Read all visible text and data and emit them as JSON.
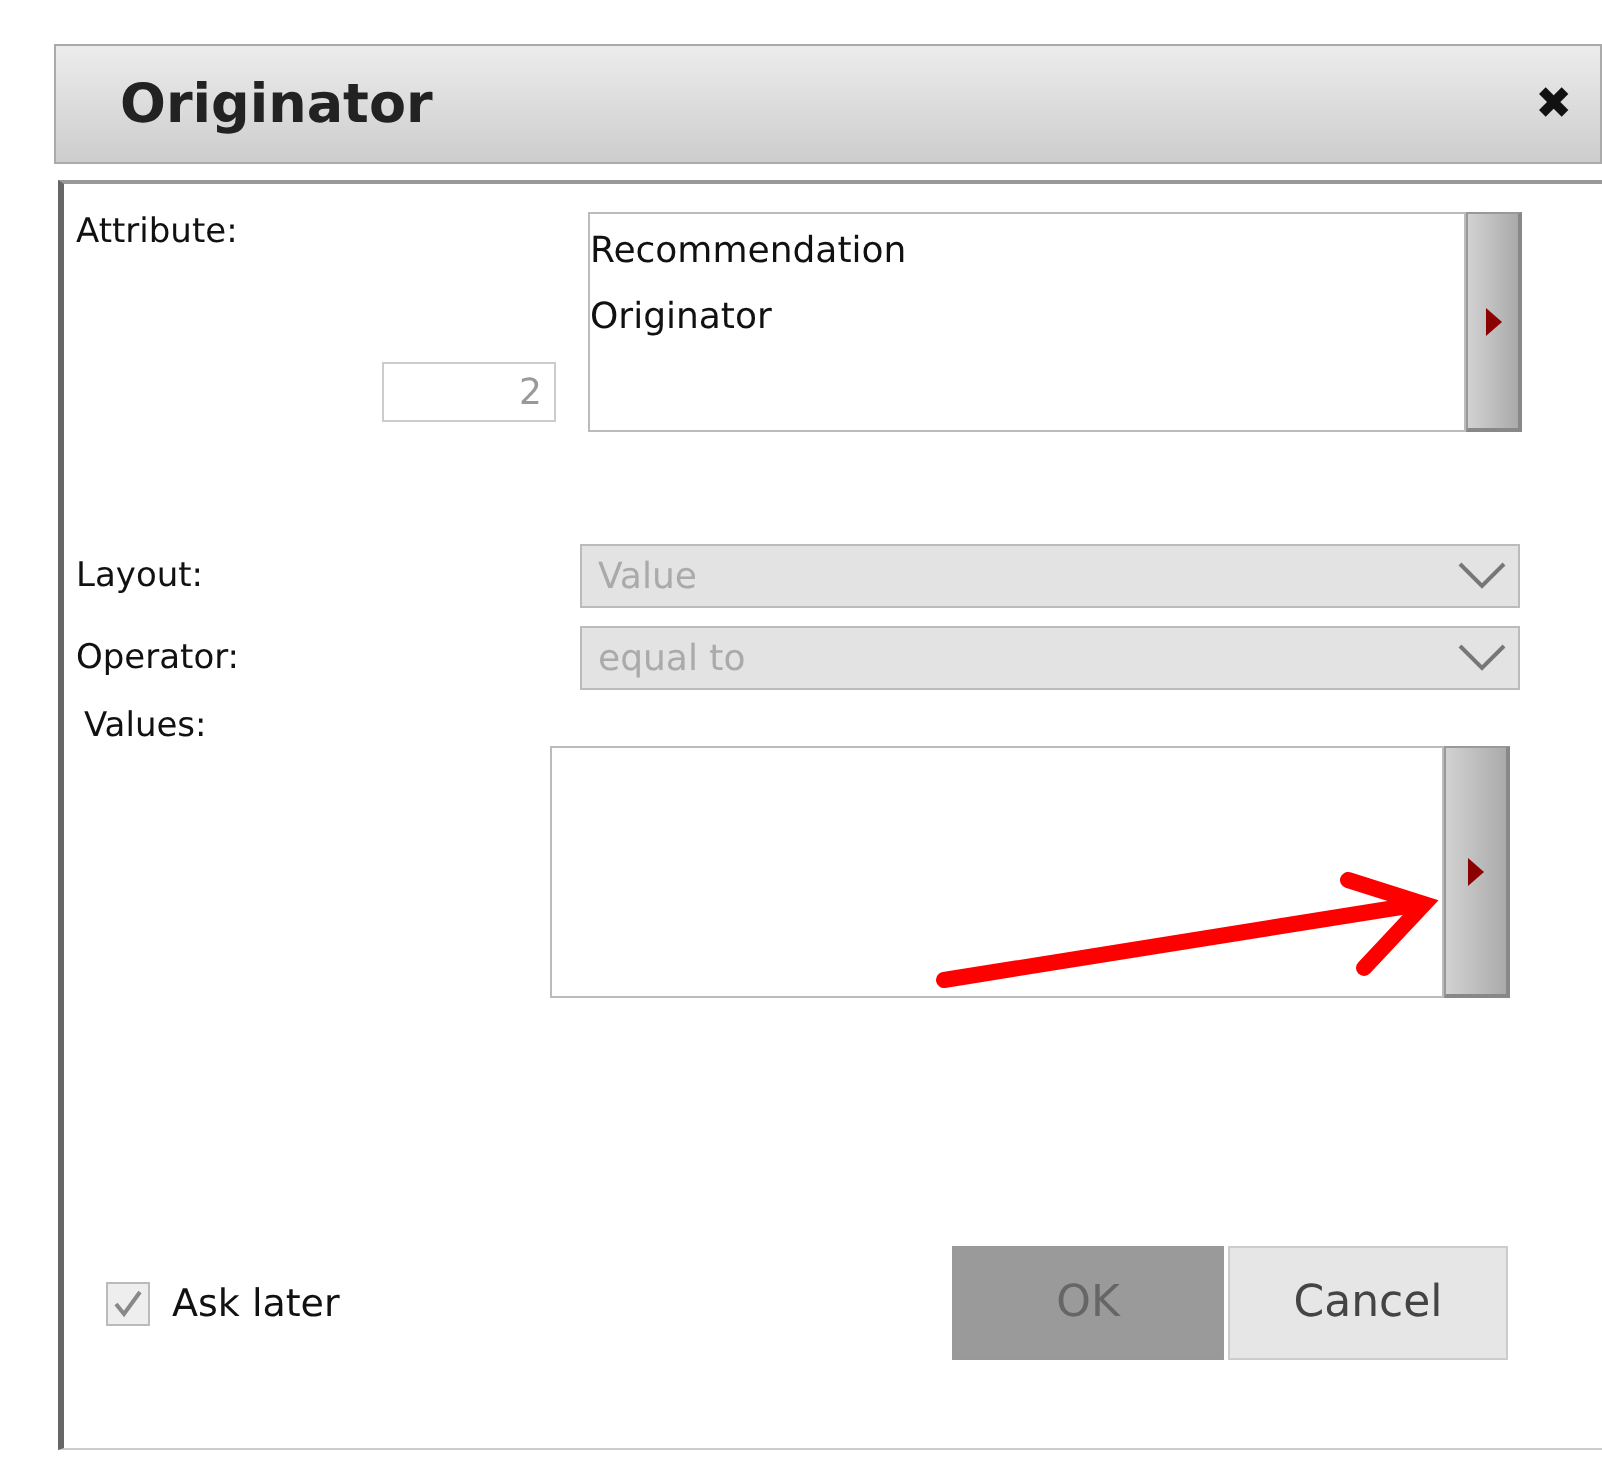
{
  "dialog": {
    "title": "Originator",
    "close_glyph": "✖"
  },
  "attribute": {
    "label": "Attribute:",
    "count": "2",
    "count_disabled": true,
    "items": [
      "Recommendation",
      "Originator"
    ]
  },
  "dropdowns": [
    {
      "label": "Layout:",
      "value": "Value",
      "disabled": true
    },
    {
      "label": "Operator:",
      "value": "equal to",
      "disabled": true
    }
  ],
  "values": {
    "label": "Values:"
  },
  "ask_later": {
    "label": "Ask later",
    "checked": true
  },
  "buttons": [
    {
      "label": "OK",
      "disabled": true
    },
    {
      "label": "Cancel",
      "disabled": false
    }
  ]
}
